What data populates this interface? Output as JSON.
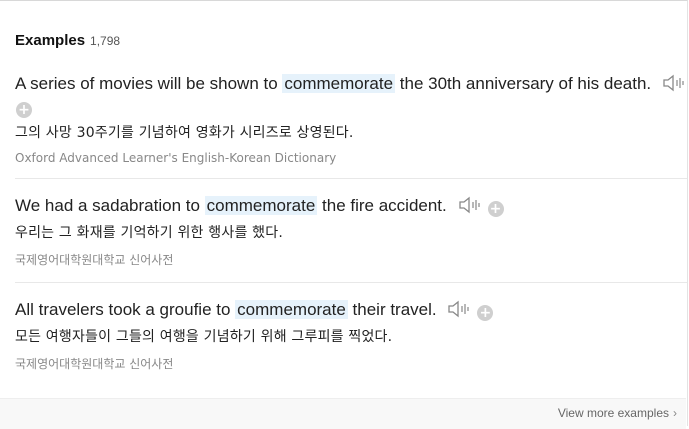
{
  "header": {
    "title": "Examples",
    "count": "1,798"
  },
  "examples": [
    {
      "en_before": "A series of movies will be shown to ",
      "keyword": "commemorate",
      "en_after": " the 30th anniversary of his death.",
      "ko": "그의 사망 30주기를 기념하여 영화가 시리즈로 상영된다.",
      "source": "Oxford Advanced Learner's English-Korean Dictionary"
    },
    {
      "en_before": "We had a sadabration to ",
      "keyword": "commemorate",
      "en_after": " the fire accident.",
      "ko": "우리는 그 화재를 기억하기 위한 행사를 했다.",
      "source": "국제영어대학원대학교 신어사전"
    },
    {
      "en_before": "All travelers took a groufie to ",
      "keyword": "commemorate",
      "en_after": " their travel.",
      "ko": "모든 여행자들이 그들의 여행을 기념하기 위해 그루피를 찍었다.",
      "source": "국제영어대학원대학교 신어사전"
    }
  ],
  "footer": {
    "view_more": "View more examples",
    "chevron": "›"
  },
  "icons": {
    "speaker": "speaker-icon",
    "add": "add-icon"
  },
  "colors": {
    "highlight": "#e6f2fb"
  }
}
